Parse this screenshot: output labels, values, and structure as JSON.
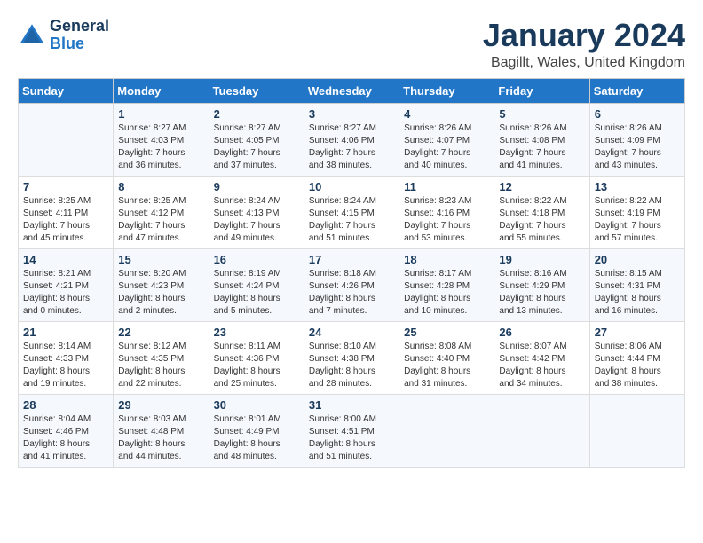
{
  "header": {
    "logo_line1": "General",
    "logo_line2": "Blue",
    "title": "January 2024",
    "subtitle": "Bagillt, Wales, United Kingdom"
  },
  "calendar": {
    "days_of_week": [
      "Sunday",
      "Monday",
      "Tuesday",
      "Wednesday",
      "Thursday",
      "Friday",
      "Saturday"
    ],
    "weeks": [
      [
        {
          "day": "",
          "info": ""
        },
        {
          "day": "1",
          "info": "Sunrise: 8:27 AM\nSunset: 4:03 PM\nDaylight: 7 hours\nand 36 minutes."
        },
        {
          "day": "2",
          "info": "Sunrise: 8:27 AM\nSunset: 4:05 PM\nDaylight: 7 hours\nand 37 minutes."
        },
        {
          "day": "3",
          "info": "Sunrise: 8:27 AM\nSunset: 4:06 PM\nDaylight: 7 hours\nand 38 minutes."
        },
        {
          "day": "4",
          "info": "Sunrise: 8:26 AM\nSunset: 4:07 PM\nDaylight: 7 hours\nand 40 minutes."
        },
        {
          "day": "5",
          "info": "Sunrise: 8:26 AM\nSunset: 4:08 PM\nDaylight: 7 hours\nand 41 minutes."
        },
        {
          "day": "6",
          "info": "Sunrise: 8:26 AM\nSunset: 4:09 PM\nDaylight: 7 hours\nand 43 minutes."
        }
      ],
      [
        {
          "day": "7",
          "info": "Sunrise: 8:25 AM\nSunset: 4:11 PM\nDaylight: 7 hours\nand 45 minutes."
        },
        {
          "day": "8",
          "info": "Sunrise: 8:25 AM\nSunset: 4:12 PM\nDaylight: 7 hours\nand 47 minutes."
        },
        {
          "day": "9",
          "info": "Sunrise: 8:24 AM\nSunset: 4:13 PM\nDaylight: 7 hours\nand 49 minutes."
        },
        {
          "day": "10",
          "info": "Sunrise: 8:24 AM\nSunset: 4:15 PM\nDaylight: 7 hours\nand 51 minutes."
        },
        {
          "day": "11",
          "info": "Sunrise: 8:23 AM\nSunset: 4:16 PM\nDaylight: 7 hours\nand 53 minutes."
        },
        {
          "day": "12",
          "info": "Sunrise: 8:22 AM\nSunset: 4:18 PM\nDaylight: 7 hours\nand 55 minutes."
        },
        {
          "day": "13",
          "info": "Sunrise: 8:22 AM\nSunset: 4:19 PM\nDaylight: 7 hours\nand 57 minutes."
        }
      ],
      [
        {
          "day": "14",
          "info": "Sunrise: 8:21 AM\nSunset: 4:21 PM\nDaylight: 8 hours\nand 0 minutes."
        },
        {
          "day": "15",
          "info": "Sunrise: 8:20 AM\nSunset: 4:23 PM\nDaylight: 8 hours\nand 2 minutes."
        },
        {
          "day": "16",
          "info": "Sunrise: 8:19 AM\nSunset: 4:24 PM\nDaylight: 8 hours\nand 5 minutes."
        },
        {
          "day": "17",
          "info": "Sunrise: 8:18 AM\nSunset: 4:26 PM\nDaylight: 8 hours\nand 7 minutes."
        },
        {
          "day": "18",
          "info": "Sunrise: 8:17 AM\nSunset: 4:28 PM\nDaylight: 8 hours\nand 10 minutes."
        },
        {
          "day": "19",
          "info": "Sunrise: 8:16 AM\nSunset: 4:29 PM\nDaylight: 8 hours\nand 13 minutes."
        },
        {
          "day": "20",
          "info": "Sunrise: 8:15 AM\nSunset: 4:31 PM\nDaylight: 8 hours\nand 16 minutes."
        }
      ],
      [
        {
          "day": "21",
          "info": "Sunrise: 8:14 AM\nSunset: 4:33 PM\nDaylight: 8 hours\nand 19 minutes."
        },
        {
          "day": "22",
          "info": "Sunrise: 8:12 AM\nSunset: 4:35 PM\nDaylight: 8 hours\nand 22 minutes."
        },
        {
          "day": "23",
          "info": "Sunrise: 8:11 AM\nSunset: 4:36 PM\nDaylight: 8 hours\nand 25 minutes."
        },
        {
          "day": "24",
          "info": "Sunrise: 8:10 AM\nSunset: 4:38 PM\nDaylight: 8 hours\nand 28 minutes."
        },
        {
          "day": "25",
          "info": "Sunrise: 8:08 AM\nSunset: 4:40 PM\nDaylight: 8 hours\nand 31 minutes."
        },
        {
          "day": "26",
          "info": "Sunrise: 8:07 AM\nSunset: 4:42 PM\nDaylight: 8 hours\nand 34 minutes."
        },
        {
          "day": "27",
          "info": "Sunrise: 8:06 AM\nSunset: 4:44 PM\nDaylight: 8 hours\nand 38 minutes."
        }
      ],
      [
        {
          "day": "28",
          "info": "Sunrise: 8:04 AM\nSunset: 4:46 PM\nDaylight: 8 hours\nand 41 minutes."
        },
        {
          "day": "29",
          "info": "Sunrise: 8:03 AM\nSunset: 4:48 PM\nDaylight: 8 hours\nand 44 minutes."
        },
        {
          "day": "30",
          "info": "Sunrise: 8:01 AM\nSunset: 4:49 PM\nDaylight: 8 hours\nand 48 minutes."
        },
        {
          "day": "31",
          "info": "Sunrise: 8:00 AM\nSunset: 4:51 PM\nDaylight: 8 hours\nand 51 minutes."
        },
        {
          "day": "",
          "info": ""
        },
        {
          "day": "",
          "info": ""
        },
        {
          "day": "",
          "info": ""
        }
      ]
    ]
  }
}
